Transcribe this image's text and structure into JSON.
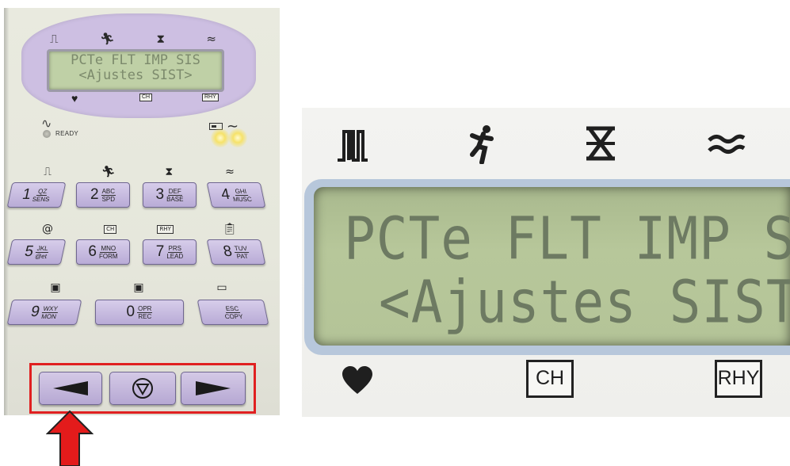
{
  "device": {
    "mode_icons": [
      "⎍",
      "🏃",
      "⧗",
      "≈"
    ],
    "lcd_lines": [
      "PCTe FLT IMP SIS",
      "<Ajustes SIST>"
    ],
    "lcd_bottom_labels": {
      "heart": "♥",
      "ch": "CH",
      "rhy": "RHY"
    },
    "ready_label": "READY",
    "row_icons": [
      [
        "⎍",
        "🏃",
        "⧗",
        "≈"
      ],
      [
        "@",
        "CH",
        "RHY",
        "📋"
      ],
      [
        "▣",
        "▣",
        "▭"
      ]
    ],
    "keys": [
      {
        "num": "1",
        "top": "QZ",
        "bottom": "SENS"
      },
      {
        "num": "2",
        "top": "ABC",
        "bottom": "SPD"
      },
      {
        "num": "3",
        "top": "DEF",
        "bottom": "BASE"
      },
      {
        "num": "4",
        "top": "GHI",
        "bottom": "MUSC"
      },
      {
        "num": "5",
        "top": "JKL",
        "bottom": "@et"
      },
      {
        "num": "6",
        "top": "MNO",
        "bottom": "FORM"
      },
      {
        "num": "7",
        "top": "PRS",
        "bottom": "LEAD"
      },
      {
        "num": "8",
        "top": "TUV",
        "bottom": "PAT"
      },
      {
        "num": "9",
        "top": "WXY",
        "bottom": "MON"
      },
      {
        "num": "0",
        "top": "OPR",
        "bottom": "REC"
      },
      {
        "num": "",
        "top": "ESC",
        "bottom": "COPY"
      }
    ],
    "nav": {
      "left": "◀",
      "stop": "▽",
      "right": "▶"
    },
    "highlight_color": "#e02020"
  },
  "zoom": {
    "lcd_line1": "PCTe FLT IMP SIS",
    "lcd_line2": "<Ajustes SIST>",
    "top_icons": [
      "⎍",
      "🏃",
      "⧗",
      "≈"
    ],
    "bottom_labels": {
      "heart": "♥",
      "ch": "CH",
      "rhy": "RHY"
    }
  }
}
